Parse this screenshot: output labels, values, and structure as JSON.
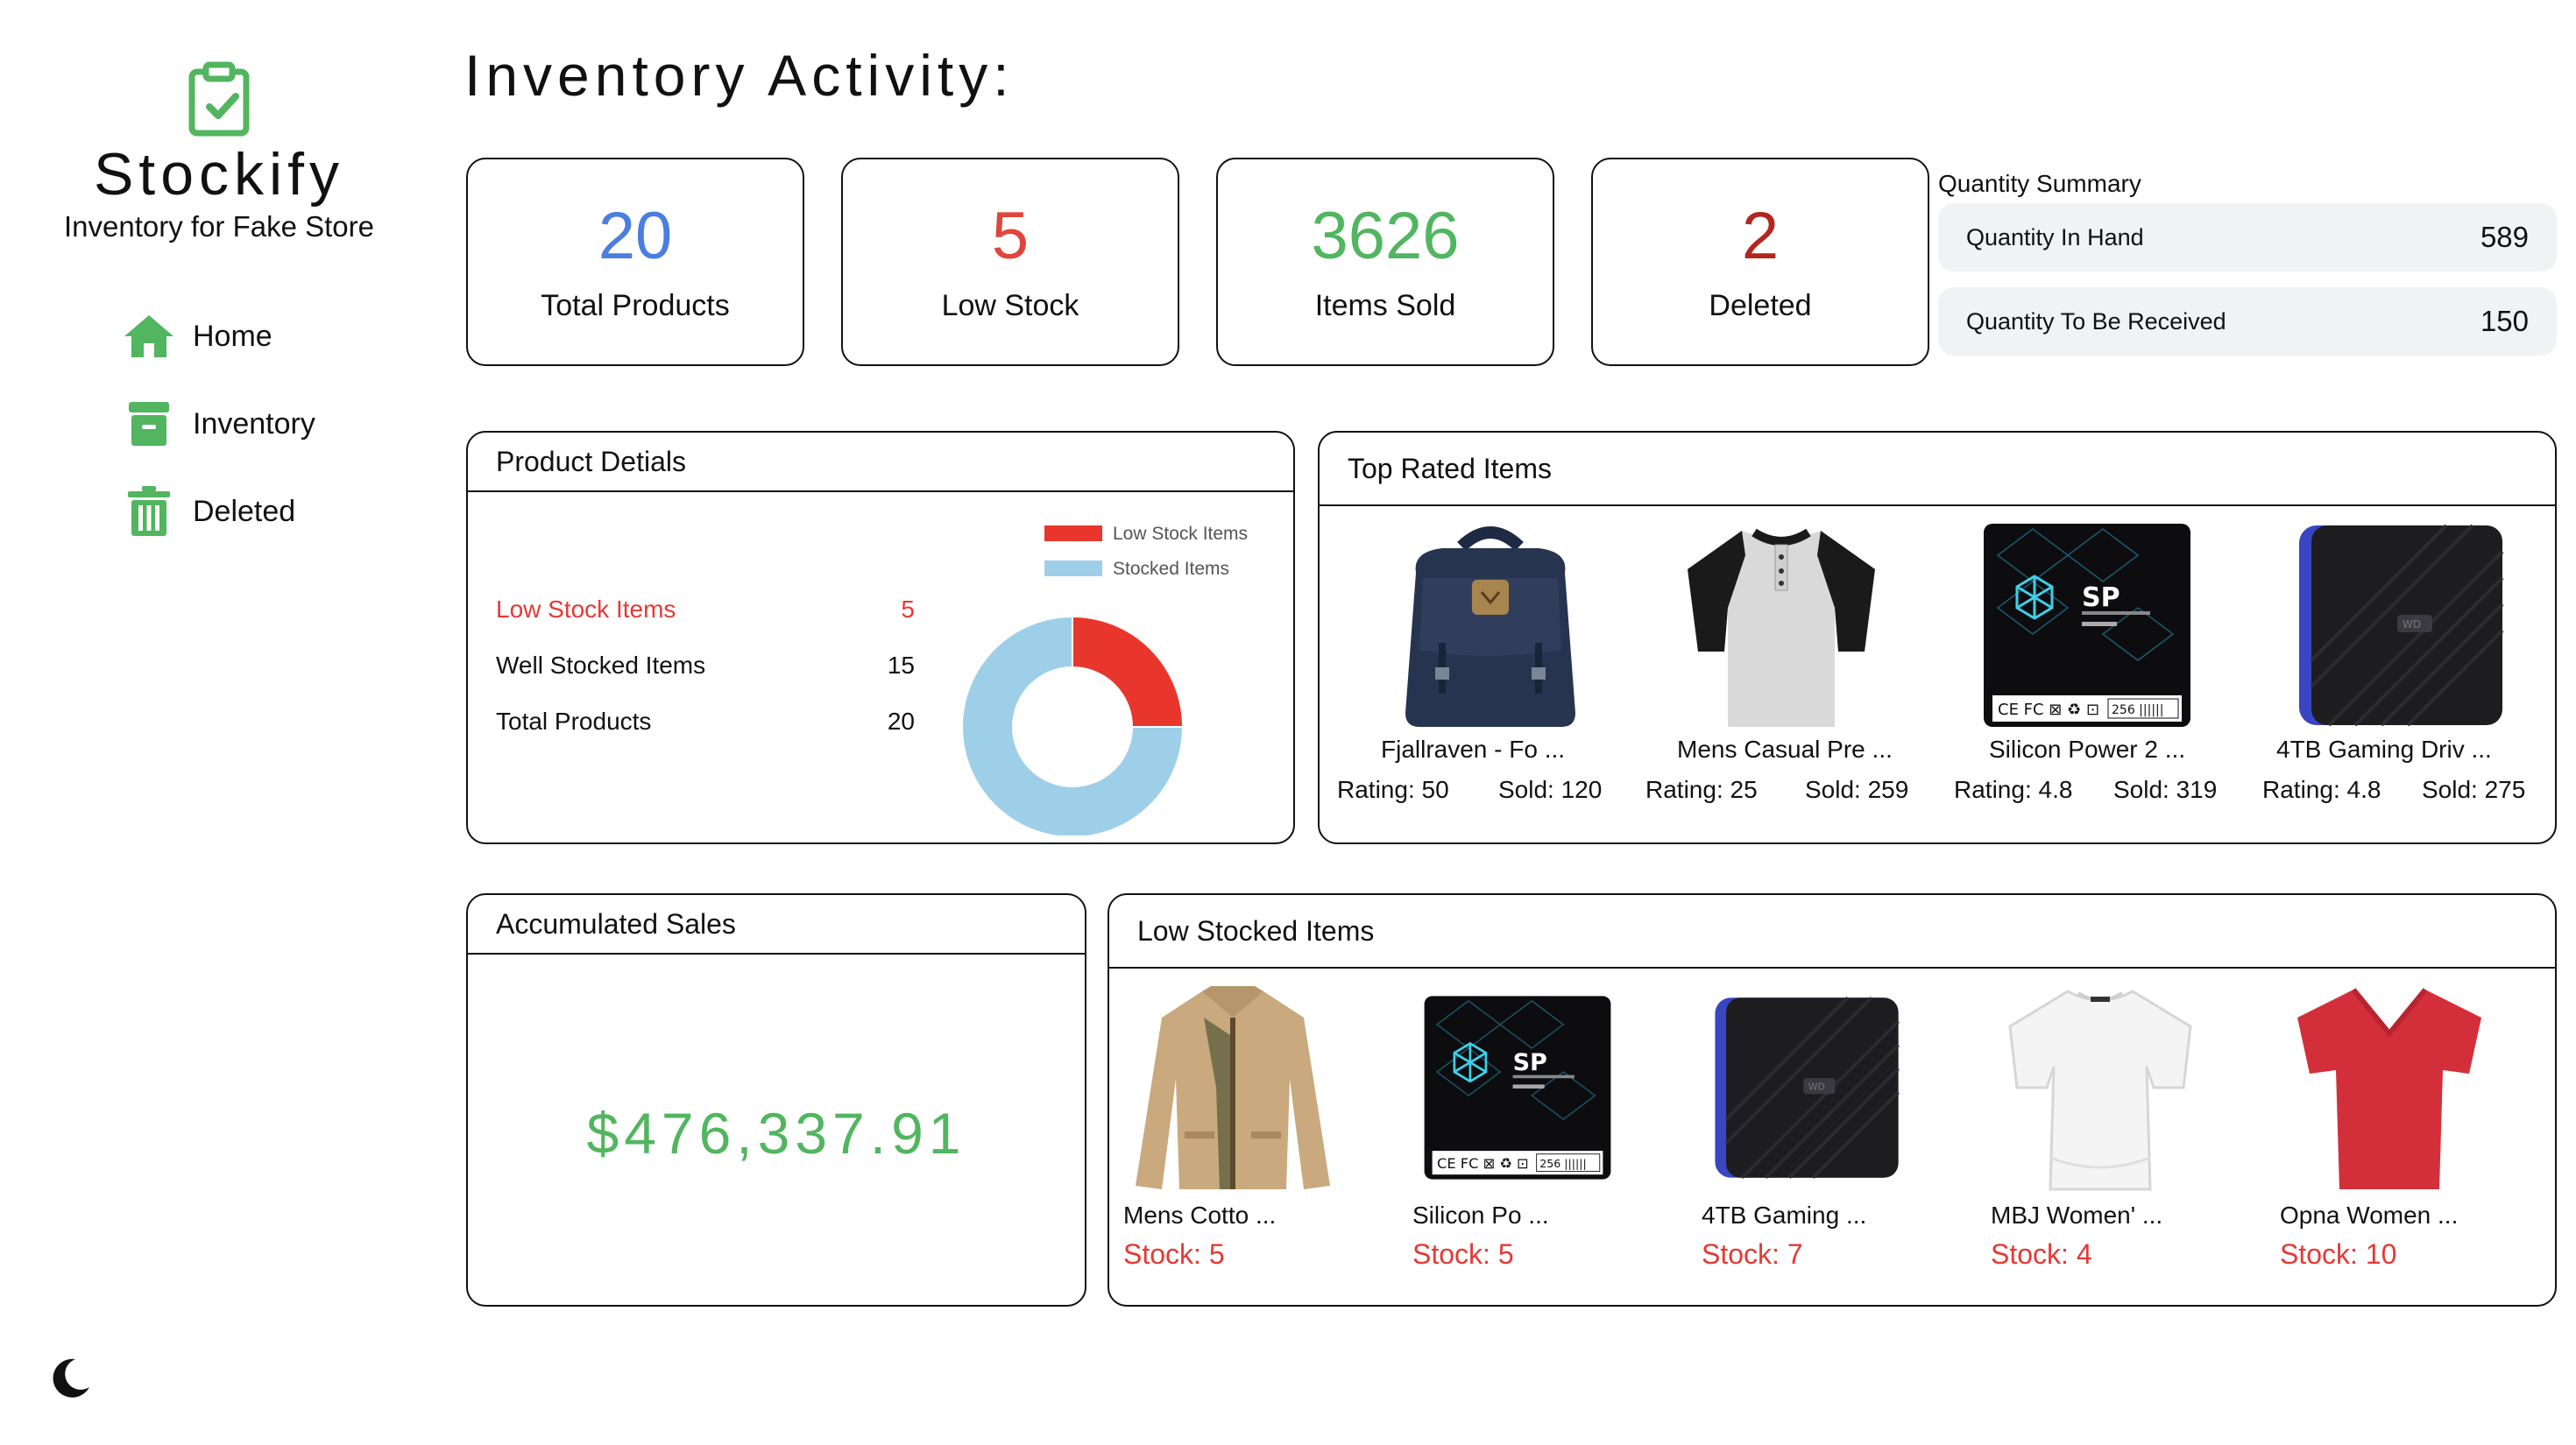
{
  "app": {
    "brand": "Stockify",
    "tagline": "Inventory for Fake Store",
    "accent_color": "#52b55f"
  },
  "sidebar": {
    "items": [
      {
        "label": "Home",
        "icon": "home-icon"
      },
      {
        "label": "Inventory",
        "icon": "archive-box-icon"
      },
      {
        "label": "Deleted",
        "icon": "trash-icon"
      }
    ],
    "theme_toggle_icon": "moon-icon"
  },
  "page": {
    "title": "Inventory Activity:"
  },
  "stats": [
    {
      "value": "20",
      "label": "Total Products",
      "color": "#4a7ee0"
    },
    {
      "value": "5",
      "label": "Low Stock",
      "color": "#e0463c"
    },
    {
      "value": "3626",
      "label": "Items Sold",
      "color": "#52b55f"
    },
    {
      "value": "2",
      "label": "Deleted",
      "color": "#b3261e"
    }
  ],
  "quantity_summary": {
    "title": "Quantity Summary",
    "rows": [
      {
        "label": "Quantity In Hand",
        "value": "589"
      },
      {
        "label": "Quantity To Be Received",
        "value": "150"
      }
    ]
  },
  "product_details": {
    "title": "Product Detials",
    "rows": [
      {
        "label": "Low Stock Items",
        "value": "5",
        "color": "#e53935"
      },
      {
        "label": "Well Stocked Items",
        "value": "15",
        "color": "#111111"
      },
      {
        "label": "Total Products",
        "value": "20",
        "color": "#111111"
      }
    ]
  },
  "chart_data": {
    "type": "pie",
    "donut": true,
    "categories": [
      "Low Stock Items",
      "Stocked Items"
    ],
    "values": [
      5,
      15
    ],
    "colors": [
      "#e8362c",
      "#9ecfe9"
    ],
    "legend_position": "top"
  },
  "top_rated": {
    "title": "Top Rated Items",
    "items": [
      {
        "name": "Fjallraven - Fo ...",
        "rating_text": "Rating: 50",
        "sold_text": "Sold: 120",
        "image": "backpack"
      },
      {
        "name": "Mens Casual Pre ...",
        "rating_text": "Rating: 25",
        "sold_text": "Sold: 259",
        "image": "raglan-shirt"
      },
      {
        "name": "Silicon Power 2 ...",
        "rating_text": "Rating: 4.8",
        "sold_text": "Sold: 319",
        "image": "ssd"
      },
      {
        "name": "4TB Gaming Driv ...",
        "rating_text": "Rating: 4.8",
        "sold_text": "Sold: 275",
        "image": "hard-drive"
      }
    ]
  },
  "accumulated_sales": {
    "title": "Accumulated Sales",
    "value": "$476,337.91"
  },
  "low_stocked": {
    "title": "Low Stocked Items",
    "items": [
      {
        "name": "Mens Cotto ...",
        "stock_text": "Stock: 5",
        "image": "jacket"
      },
      {
        "name": "Silicon Po ...",
        "stock_text": "Stock: 5",
        "image": "ssd"
      },
      {
        "name": "4TB Gaming ...",
        "stock_text": "Stock: 7",
        "image": "hard-drive"
      },
      {
        "name": "MBJ Women' ...",
        "stock_text": "Stock: 4",
        "image": "white-tee"
      },
      {
        "name": "Opna Women ...",
        "stock_text": "Stock: 10",
        "image": "red-tee"
      }
    ]
  }
}
